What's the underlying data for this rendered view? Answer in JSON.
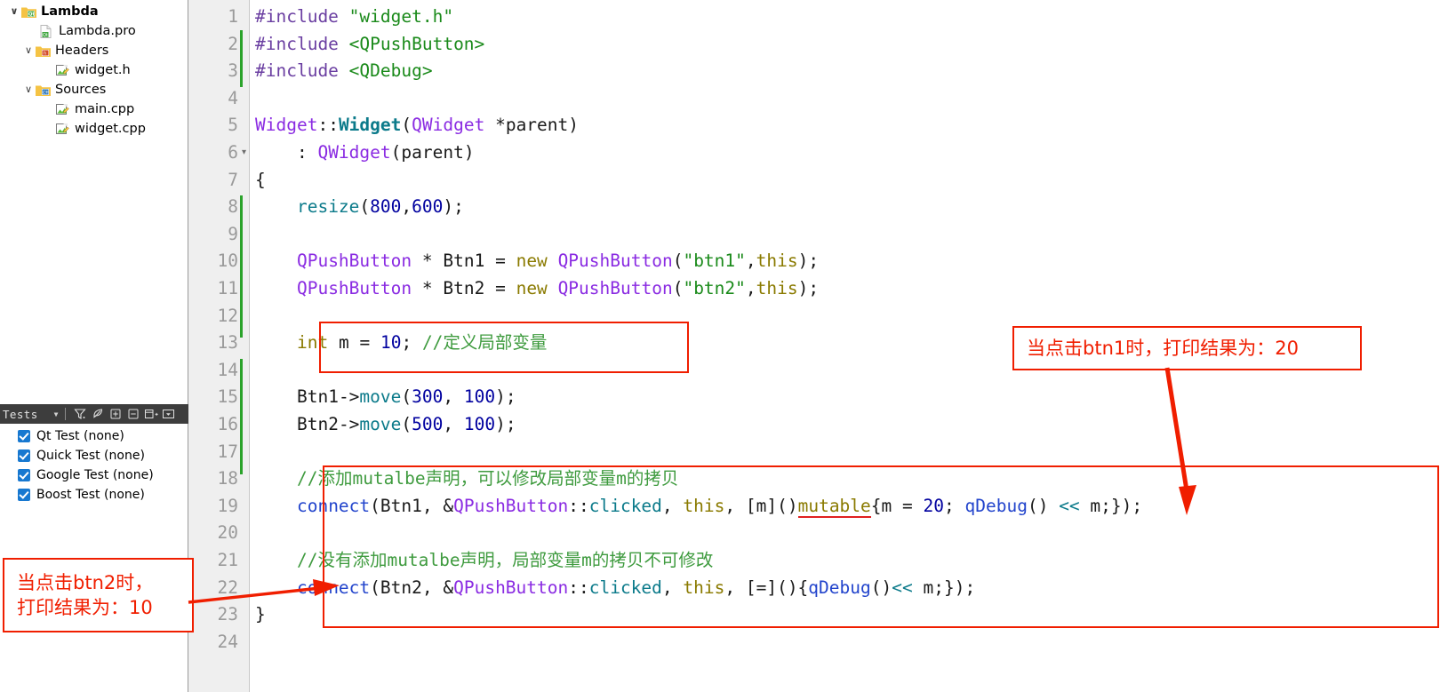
{
  "project_tree": {
    "items": [
      {
        "label": "Lambda",
        "depth": 0,
        "chevron": "v",
        "icon": "qt-folder-icon",
        "bold": true
      },
      {
        "label": "Lambda.pro",
        "depth": 1,
        "chevron": "",
        "icon": "qt-file-icon",
        "bold": false
      },
      {
        "label": "Headers",
        "depth": 1,
        "chevron": "v",
        "icon": "headers-folder-icon",
        "bold": false
      },
      {
        "label": "widget.h",
        "depth": 2,
        "chevron": "",
        "icon": "source-file-icon",
        "bold": false
      },
      {
        "label": "Sources",
        "depth": 1,
        "chevron": "v",
        "icon": "cpp-folder-icon",
        "bold": false
      },
      {
        "label": "main.cpp",
        "depth": 2,
        "chevron": "",
        "icon": "source-file-icon",
        "bold": false
      },
      {
        "label": "widget.cpp",
        "depth": 2,
        "chevron": "",
        "icon": "source-file-icon",
        "bold": false
      }
    ]
  },
  "tests_pane": {
    "combo_label": "Tests",
    "combo_arrow": "▼",
    "toolbar_icons": [
      "filter-icon",
      "leaf-icon",
      "expand-all-icon",
      "collapse-all-icon",
      "add-pane-icon",
      "pane-options-icon"
    ],
    "items": [
      {
        "label": "Qt Test (none)",
        "checked": true
      },
      {
        "label": "Quick Test (none)",
        "checked": true
      },
      {
        "label": "Google Test (none)",
        "checked": true
      },
      {
        "label": "Boost Test (none)",
        "checked": true
      }
    ]
  },
  "editor": {
    "line_numbers": [
      "1",
      "2",
      "3",
      "4",
      "5",
      "6",
      "7",
      "8",
      "9",
      "10",
      "11",
      "12",
      "13",
      "14",
      "15",
      "16",
      "17",
      "18",
      "19",
      "20",
      "21",
      "22",
      "23",
      "24"
    ],
    "fold_marker_line": "6",
    "fold_marker_glyph": "▾",
    "lines": [
      {
        "n": "1",
        "text": "#include \"widget.h\""
      },
      {
        "n": "2",
        "text": "#include <QPushButton>"
      },
      {
        "n": "3",
        "text": "#include <QDebug>"
      },
      {
        "n": "4",
        "text": ""
      },
      {
        "n": "5",
        "text": "Widget::Widget(QWidget *parent)"
      },
      {
        "n": "6",
        "text": "    : QWidget(parent)"
      },
      {
        "n": "7",
        "text": "{"
      },
      {
        "n": "8",
        "text": "    resize(800,600);"
      },
      {
        "n": "9",
        "text": ""
      },
      {
        "n": "10",
        "text": "    QPushButton * Btn1 = new QPushButton(\"btn1\",this);"
      },
      {
        "n": "11",
        "text": "    QPushButton * Btn2 = new QPushButton(\"btn2\",this);"
      },
      {
        "n": "12",
        "text": ""
      },
      {
        "n": "13",
        "text": "    int m = 10; //定义局部变量"
      },
      {
        "n": "14",
        "text": ""
      },
      {
        "n": "15",
        "text": "    Btn1->move(300, 100);"
      },
      {
        "n": "16",
        "text": "    Btn2->move(500, 100);"
      },
      {
        "n": "17",
        "text": ""
      },
      {
        "n": "18",
        "text": "    //添加mutalbe声明后，可以修改局部变量m的拷贝"
      },
      {
        "n": "19",
        "text": "    connect(Btn1, &QPushButton::clicked, this, [m]()mutable{m = 20; qDebug() << m;});"
      },
      {
        "n": "20",
        "text": ""
      },
      {
        "n": "21",
        "text": "    //没有添加mutalbe声明，局部变量m的拷贝不可修改"
      },
      {
        "n": "22",
        "text": "    connect(Btn2, &QPushButton::clicked, this, [=](){qDebug()<< m;});"
      },
      {
        "n": "23",
        "text": "}"
      },
      {
        "n": "24",
        "text": ""
      }
    ]
  },
  "annotations": {
    "note_btn1": "当点击btn1时，打印结果为：20",
    "note_btn2_line1": "当点击btn2时，",
    "note_btn2_line2": "打印结果为：10",
    "accent_color": "#f01e00",
    "highlight_boxes": [
      "declaration-box",
      "lambda-block-box"
    ],
    "underline_token": "mutable"
  }
}
